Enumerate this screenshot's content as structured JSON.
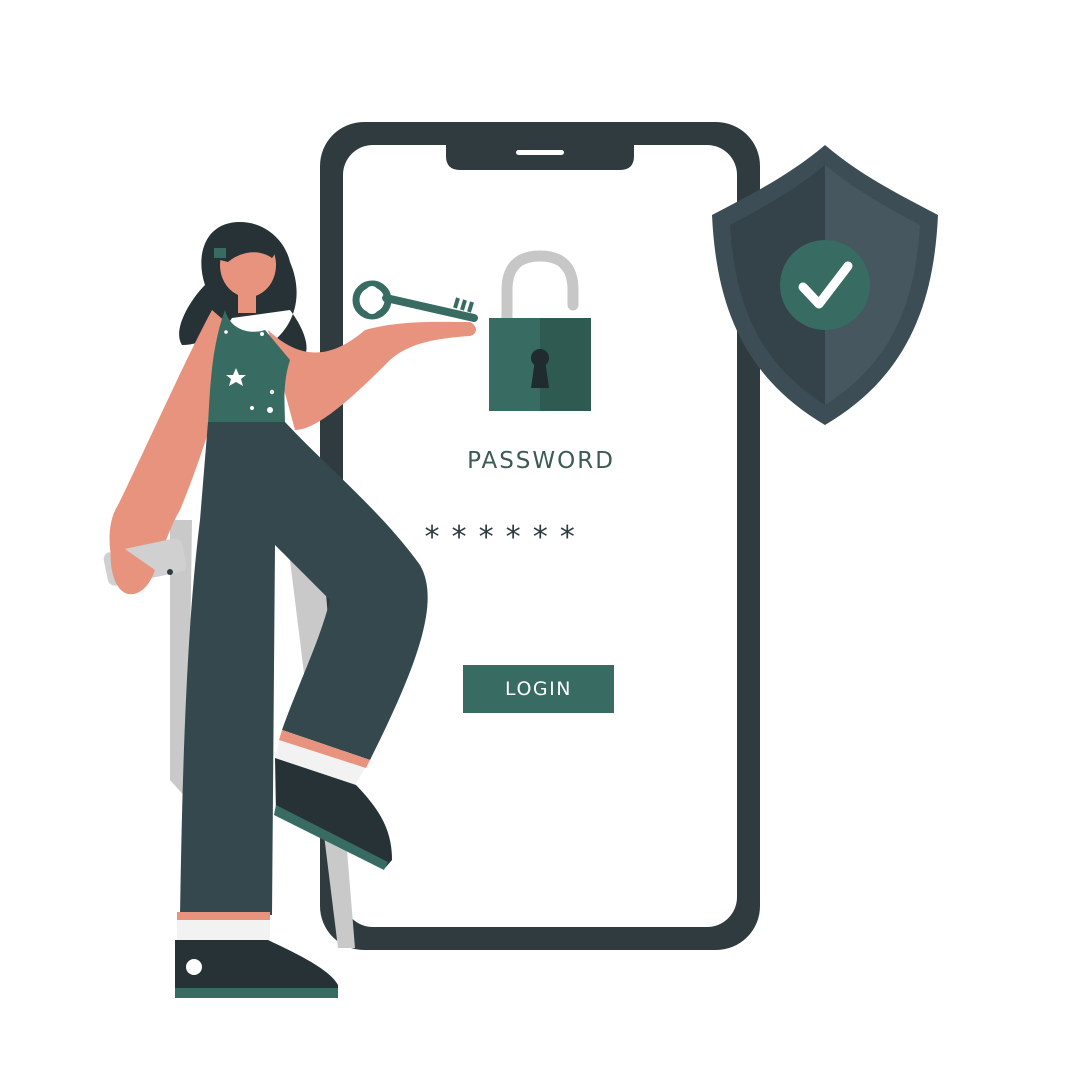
{
  "screen": {
    "password_label": "PASSWORD",
    "password_mask": "******",
    "login_label": "LOGIN"
  },
  "icons": [
    "padlock-icon",
    "key-icon",
    "shield-check-icon",
    "smartphone-icon"
  ],
  "colors": {
    "accent_green": "#386b62",
    "phone_frame": "#2f3b3f",
    "skin": "#e8937e",
    "shield": "#3d4d55"
  }
}
